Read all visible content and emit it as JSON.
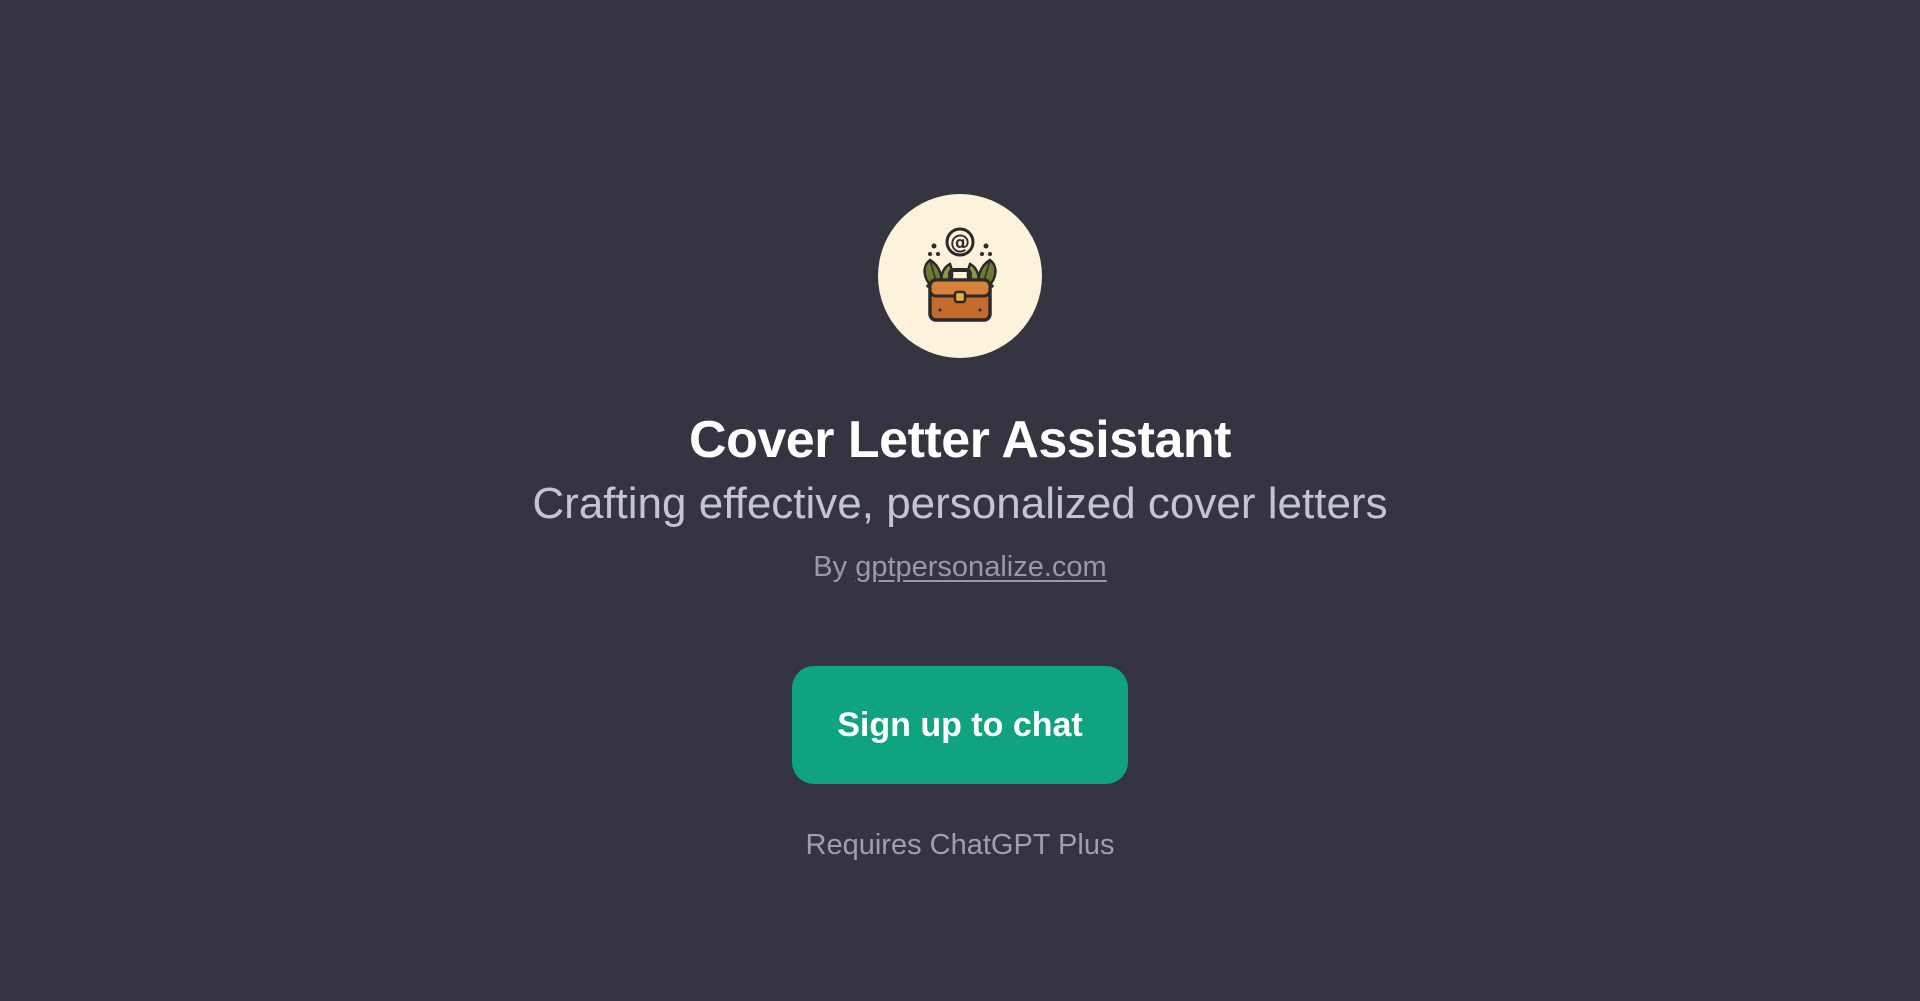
{
  "gpt": {
    "icon": "briefcase-with-leaves-and-at-sign-icon",
    "title": "Cover Letter Assistant",
    "description": "Crafting effective, personalized cover letters",
    "by_prefix": "By",
    "author": "gptpersonalize.com"
  },
  "cta": {
    "label": "Sign up to chat",
    "note": "Requires ChatGPT Plus"
  },
  "colors": {
    "background": "#343541",
    "accent": "#10a37f",
    "avatar_bg": "#fdf3dc"
  }
}
